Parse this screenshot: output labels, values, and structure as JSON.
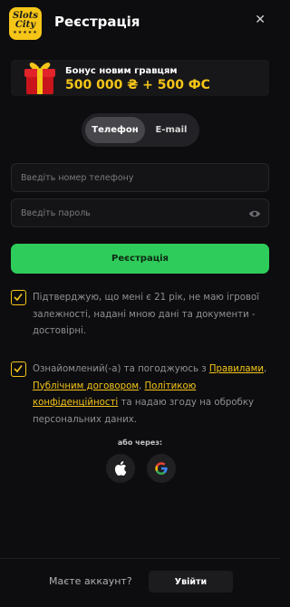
{
  "header": {
    "logo_line1": "Slots",
    "logo_line2": "City",
    "logo_stars": "★★★★★",
    "title": "Реєстрація"
  },
  "bonus": {
    "label": "Бонус новим гравцям",
    "value": "500 000 ₴ + 500 ФС"
  },
  "tabs": [
    {
      "label": "Телефон",
      "active": true
    },
    {
      "label": "E-mail",
      "active": false
    }
  ],
  "form": {
    "phone_placeholder": "Введіть номер телефону",
    "password_placeholder": "Введіть пароль",
    "submit_label": "Реєстрація"
  },
  "consent1": {
    "checked": true,
    "text": "Підтверджую, що мені є 21 рік, не маю ігрової залежності, надані мною дані та документи - достовірні."
  },
  "consent2": {
    "checked": true,
    "text_before": "Ознайомлений(-а) та погоджуюсь з ",
    "link_rules": "Правилами",
    "sep1": ", ",
    "link_offer": "Публічним договором",
    "sep2": ", ",
    "link_privacy": "Політикою конфіденційності",
    "text_after": " та надаю згоду на обробку персональних даних."
  },
  "social": {
    "or_label": "або через:"
  },
  "footer": {
    "question": "Маєте аккаунт?",
    "login_label": "Увійти"
  },
  "colors": {
    "accent": "#f5c518",
    "primary_button": "#2ecc5a",
    "background": "#0d0d0f"
  }
}
